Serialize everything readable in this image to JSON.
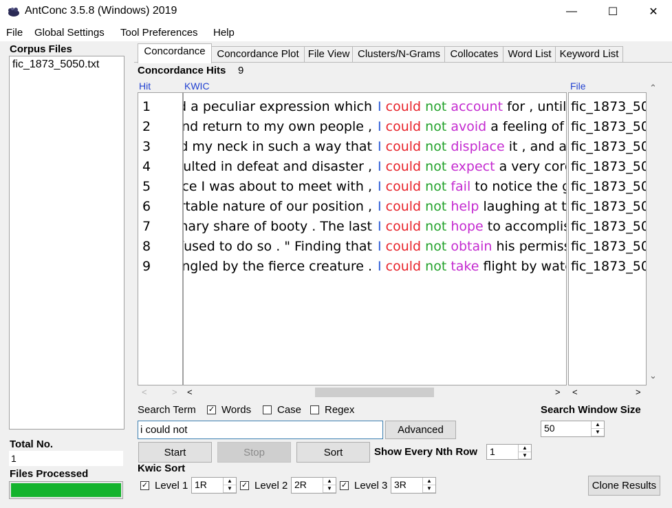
{
  "window": {
    "title": "AntConc 3.5.8 (Windows) 2019",
    "minimize": "—",
    "maximize": "☐",
    "close": "✕"
  },
  "menu": [
    "File",
    "Global Settings",
    "Tool Preferences",
    "Help"
  ],
  "left_panel": {
    "corpus_files_label": "Corpus Files",
    "files": [
      "fic_1873_5050.txt"
    ],
    "total_no_label": "Total No.",
    "total_no_value": "1",
    "files_processed_label": "Files Processed",
    "files_processed_progress": 1.0
  },
  "tabs": [
    "Concordance",
    "Concordance Plot",
    "File View",
    "Clusters/N-Grams",
    "Collocates",
    "Word List",
    "Keyword List"
  ],
  "concordance": {
    "hits_label": "Concordance Hits",
    "hits_count": "9",
    "col_hit": "Hit",
    "col_kwic": "KWIC",
    "col_file": "File",
    "rows": [
      {
        "hit": "1",
        "left": "d a peculiar expression which",
        "i": "I",
        "could": "could",
        "not": "not",
        "verb": "account",
        "right": " for , until",
        "file": "fic_1873_50"
      },
      {
        "hit": "2",
        "left": "nd return to my own people ,",
        "i": "I",
        "could": "could",
        "not": "not",
        "verb": "avoid",
        "right": " a feeling of r",
        "file": "fic_1873_50"
      },
      {
        "hit": "3",
        "left": "d my neck in such a way that",
        "i": "I",
        "could": "could",
        "not": "not",
        "verb": "displace",
        "right": " it , and ag",
        "file": "fic_1873_50"
      },
      {
        "hit": "4",
        "left": "sulted in defeat and disaster ,",
        "i": "I",
        "could": "could",
        "not": "not",
        "verb": "expect",
        "right": " a very cord",
        "file": "fic_1873_50"
      },
      {
        "hit": "5",
        "left": "ce I was about to meet with ,",
        "i": "I",
        "could": "could",
        "not": "not",
        "verb": "fail",
        "right": " to notice the g",
        "file": "fic_1873_50"
      },
      {
        "hit": "6",
        "left": "rtable nature of our position ,",
        "i": "I",
        "could": "could",
        "not": "not",
        "verb": "help",
        "right": " laughing at th",
        "file": "fic_1873_50"
      },
      {
        "hit": "7",
        "left": "inary share of booty . The last",
        "i": "I",
        "could": "could",
        "not": "not",
        "verb": "hope",
        "right": " to accomplis",
        "file": "fic_1873_50"
      },
      {
        "hit": "8",
        "left": "fused to do so . \" Finding that",
        "i": "I",
        "could": "could",
        "not": "not",
        "verb": "obtain",
        "right": " his permiss",
        "file": "fic_1873_50"
      },
      {
        "hit": "9",
        "left": "angled by the fierce creature .",
        "i": "I",
        "could": "could",
        "not": "not",
        "verb": "take",
        "right": " flight by wate",
        "file": "fic_1873_50"
      }
    ]
  },
  "search": {
    "search_term_label": "Search Term",
    "words_label": "Words",
    "words_checked": true,
    "case_label": "Case",
    "case_checked": false,
    "regex_label": "Regex",
    "regex_checked": false,
    "query": "i could not",
    "advanced_label": "Advanced",
    "window_size_label": "Search Window Size",
    "window_size_value": "50",
    "start_label": "Start",
    "stop_label": "Stop",
    "sort_label": "Sort",
    "nth_row_label": "Show Every Nth Row",
    "nth_row_value": "1"
  },
  "kwic_sort": {
    "label": "Kwic Sort",
    "levels": [
      {
        "label": "Level 1",
        "value": "1R",
        "checked": true
      },
      {
        "label": "Level 2",
        "value": "2R",
        "checked": true
      },
      {
        "label": "Level 3",
        "value": "3R",
        "checked": true
      }
    ],
    "clone_label": "Clone Results"
  },
  "colors": {
    "i": "#2a5bd7",
    "could": "#e8222a",
    "not": "#22a22a",
    "verb": "#c42ad0",
    "progress": "#14b32d",
    "header_text": "#1f3fd0"
  }
}
